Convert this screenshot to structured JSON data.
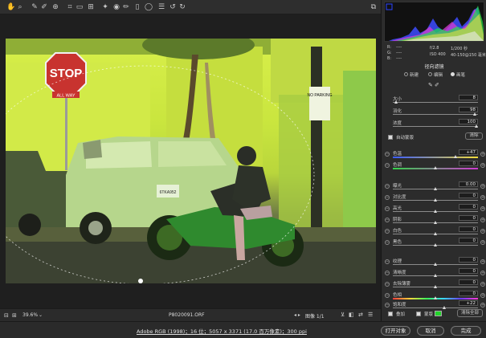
{
  "toolbar": {
    "icons": [
      "hand-icon",
      "zoom-icon",
      "white-balance-icon",
      "color-sampler-icon",
      "crop-icon",
      "straighten-icon",
      "transform-icon",
      "spot-removal-icon",
      "red-eye-icon",
      "adjustment-brush-icon",
      "graduated-filter-icon",
      "radial-filter-icon",
      "preferences-icon",
      "rotate-ccw-icon",
      "rotate-cw-icon"
    ],
    "fullscreen": "fullscreen-icon"
  },
  "photo": {
    "stop_sign": "STOP",
    "all_way": "ALL WAY",
    "no_parking": "NO PARKING",
    "plate": "6TKA952"
  },
  "status": {
    "zoom": "39.6%",
    "filename": "P8020091.ORF",
    "image_counter": "图像 1/1"
  },
  "bottom": {
    "workflow": "Adobe RGB (1998)；16 位；5057 x 3371 (17.0 百万像素)；300 ppi",
    "open_btn": "打开对象",
    "cancel_btn": "取消",
    "done_btn": "完成"
  },
  "readout": {
    "r": "R:",
    "g": "G:",
    "b": "B:",
    "r_val": "----",
    "g_val": "----",
    "b_val": "----",
    "exposure": "f/2.8",
    "shutter": "1/200 秒",
    "iso": "ISO 400",
    "lens": "40-150@150 毫米"
  },
  "panel": {
    "title": "径向滤镜",
    "modes": [
      "新建",
      "编辑",
      "画笔"
    ],
    "brush": [
      {
        "label": "大小",
        "value": "8"
      },
      {
        "label": "羽化",
        "value": "98"
      },
      {
        "label": "浓度",
        "value": "100"
      }
    ],
    "auto_mask": "自动蒙版",
    "clear": "清除",
    "sliders": [
      {
        "label": "色温",
        "value": "+47",
        "pos": 0.74,
        "grad": "temp"
      },
      {
        "label": "色调",
        "value": "0",
        "pos": 0.5,
        "grad": "tint"
      },
      {
        "label": "曝光",
        "value": "0.00",
        "pos": 0.5
      },
      {
        "label": "对比度",
        "value": "0",
        "pos": 0.5
      },
      {
        "label": "高光",
        "value": "0",
        "pos": 0.5
      },
      {
        "label": "阴影",
        "value": "0",
        "pos": 0.5
      },
      {
        "label": "白色",
        "value": "0",
        "pos": 0.5
      },
      {
        "label": "黑色",
        "value": "0",
        "pos": 0.5
      },
      {
        "label": "纹理",
        "value": "0",
        "pos": 0.5
      },
      {
        "label": "清晰度",
        "value": "0",
        "pos": 0.5
      },
      {
        "label": "去除薄雾",
        "value": "0",
        "pos": 0.5
      },
      {
        "label": "色相",
        "value": "0",
        "pos": 0.5,
        "grad": "hue"
      },
      {
        "label": "饱和度",
        "value": "+22",
        "pos": 0.61
      }
    ],
    "overlay": "叠加",
    "mask": "蒙版",
    "clear_all": "清除全部",
    "mask_color": "#22d42a"
  }
}
